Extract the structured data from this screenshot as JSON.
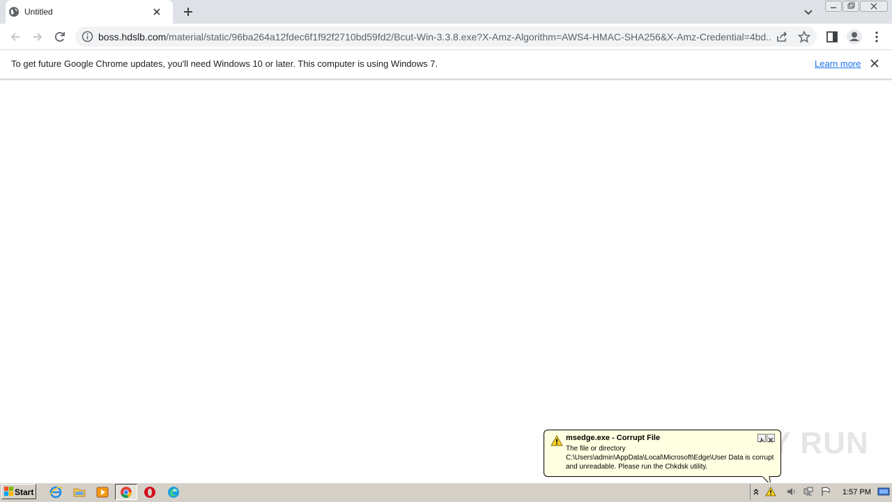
{
  "browser": {
    "tab": {
      "title": "Untitled"
    },
    "address": {
      "host": "boss.hdslb.com",
      "path": "/material/static/96ba264a12fdec6f1f92f2710bd59fd2/Bcut-Win-3.3.8.exe?X-Amz-Algorithm=AWS4-HMAC-SHA256&X-Amz-Credential=4bd..."
    },
    "infobar": {
      "message": "To get future Google Chrome updates, you'll need Windows 10 or later. This computer is using Windows 7.",
      "link": "Learn more"
    }
  },
  "taskbar": {
    "start_label": "Start",
    "clock": "1:57 PM"
  },
  "balloon": {
    "title": "msedge.exe - Corrupt File",
    "text": "The file or directory C:\\Users\\admin\\AppData\\Local\\Microsoft\\Edge\\User Data is corrupt and unreadable. Please run the Chkdsk utility."
  },
  "watermark": "ANY RUN"
}
